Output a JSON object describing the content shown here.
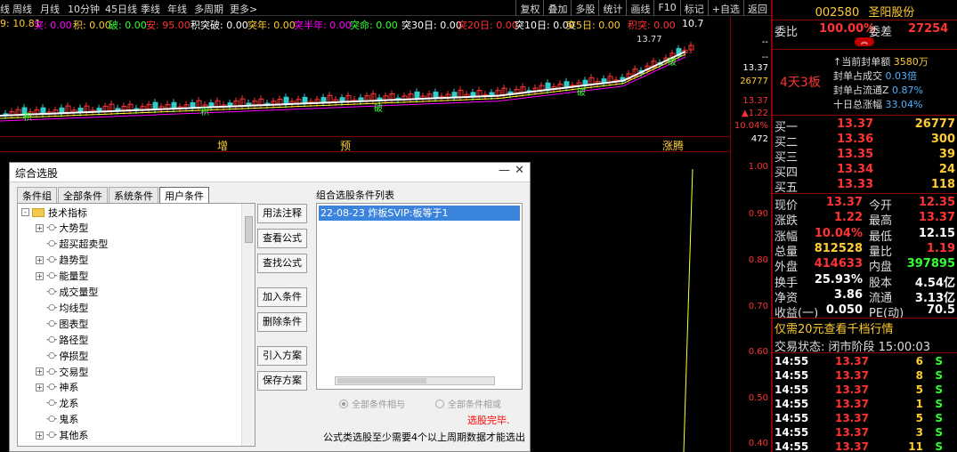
{
  "toolbar": {
    "left_items": [
      "线",
      "周线",
      "月线",
      "10分钟",
      "45日线",
      "季线",
      "年线",
      "多周期",
      "更多>"
    ],
    "right_items": [
      "复权",
      "叠加",
      "多股",
      "统计",
      "画线",
      "F10",
      "标记",
      "+自选",
      "返回"
    ]
  },
  "indicators": [
    {
      "text": "9: 10.81",
      "color": "#ffcc33"
    },
    {
      "text": "突: 0.00",
      "color": "#ff00ff"
    },
    {
      "text": "积: 0.00",
      "color": "#ffcc33"
    },
    {
      "text": "破: 0.00",
      "color": "#33ff33"
    },
    {
      "text": "安: 95.00",
      "color": "#ff3333"
    },
    {
      "text": "积突破: 0.00",
      "color": "#ffffff"
    },
    {
      "text": "突年: 0.00",
      "color": "#ffcc33"
    },
    {
      "text": "突半年: 0.00",
      "color": "#ff00ff"
    },
    {
      "text": "突命: 0.00",
      "color": "#33ff33"
    },
    {
      "text": "突30日: 0.00",
      "color": "#ffffff"
    },
    {
      "text": "突20日: 0.00",
      "color": "#ff3333"
    },
    {
      "text": "突10日: 0.00",
      "color": "#ffffff"
    },
    {
      "text": "突5日: 0.00",
      "color": "#ffcc33"
    },
    {
      "text": "积突: 0.00",
      "color": "#ff3333"
    },
    {
      "text": "10.7",
      "color": "#ffffff"
    }
  ],
  "price_chart": {
    "max_label": "13.77",
    "markers": [
      "积",
      "积",
      "破",
      "破",
      "破"
    ]
  },
  "signals": [
    "增",
    "预",
    "涨腾"
  ],
  "axis": {
    "top": [
      {
        "text": "--",
        "color": "#ffffff"
      },
      {
        "text": "--",
        "color": "#ffffff"
      },
      {
        "text": "13.37",
        "color": "#ffffff"
      },
      {
        "text": "26777",
        "color": "#ffcc33"
      },
      {
        "text": "13.37",
        "color": "#ff3333"
      },
      {
        "text": "▲1.22",
        "color": "#ff3333"
      },
      {
        "text": "10.04%",
        "color": "#ff3333"
      },
      {
        "text": "472",
        "color": "#ffffff"
      }
    ],
    "bottom": [
      "1.00",
      "0.90",
      "0.80",
      "0.70",
      "0.60",
      "0.50",
      "0.40"
    ]
  },
  "quote": {
    "code": "002580",
    "name": "圣阳股份",
    "weibi_label": "委比",
    "weibi_value": "100.00%",
    "weicha_label": "委差",
    "weicha_value": "27254",
    "board": "4天3板",
    "seal": [
      {
        "label": "↑当前封单额",
        "value": "3580万"
      },
      {
        "label": "封单占成交",
        "value": "0.03倍"
      },
      {
        "label": "封单占流通Z",
        "value": "0.87%"
      },
      {
        "label": "十日总涨幅",
        "value": "33.04%"
      }
    ],
    "buy": [
      {
        "label": "买一",
        "price": "13.37",
        "vol": "26777"
      },
      {
        "label": "买二",
        "price": "13.36",
        "vol": "300"
      },
      {
        "label": "买三",
        "price": "13.35",
        "vol": "39"
      },
      {
        "label": "买四",
        "price": "13.34",
        "vol": "24"
      },
      {
        "label": "买五",
        "price": "13.33",
        "vol": "118"
      }
    ],
    "stats": [
      {
        "l1": "现价",
        "v1": "13.37",
        "c1": "#ff3333",
        "l2": "今开",
        "v2": "12.35",
        "c2": "#ff3333"
      },
      {
        "l1": "涨跌",
        "v1": "1.22",
        "c1": "#ff3333",
        "l2": "最高",
        "v2": "13.37",
        "c2": "#ff3333"
      },
      {
        "l1": "涨幅",
        "v1": "10.04%",
        "c1": "#ff3333",
        "l2": "最低",
        "v2": "12.15",
        "c2": "#ffffff"
      },
      {
        "l1": "总量",
        "v1": "812528",
        "c1": "#ffcc33",
        "l2": "量比",
        "v2": "1.19",
        "c2": "#ff3333"
      },
      {
        "l1": "外盘",
        "v1": "414633",
        "c1": "#ff3333",
        "l2": "内盘",
        "v2": "397895",
        "c2": "#33ff33"
      },
      {
        "l1": "换手",
        "v1": "25.93%",
        "c1": "#ffffff",
        "l2": "股本",
        "v2": "4.54亿",
        "c2": "#ffffff"
      },
      {
        "l1": "净资",
        "v1": "3.86",
        "c1": "#ffffff",
        "l2": "流通",
        "v2": "3.13亿",
        "c2": "#ffffff"
      },
      {
        "l1": "收益(一)",
        "v1": "0.050",
        "c1": "#ffffff",
        "l2": "PE(动)",
        "v2": "70.5",
        "c2": "#ffffff"
      }
    ],
    "promo": "仅需20元查看千档行情",
    "trade_status": "交易状态: 闭市阶段 15:00:03",
    "ticks": [
      {
        "time": "14:55",
        "price": "13.37",
        "vol": "6",
        "flag": "S"
      },
      {
        "time": "14:55",
        "price": "13.37",
        "vol": "8",
        "flag": "S"
      },
      {
        "time": "14:55",
        "price": "13.37",
        "vol": "5",
        "flag": "S"
      },
      {
        "time": "14:55",
        "price": "13.37",
        "vol": "1",
        "flag": "S"
      },
      {
        "time": "14:55",
        "price": "13.37",
        "vol": "5",
        "flag": "S"
      },
      {
        "time": "14:55",
        "price": "13.37",
        "vol": "3",
        "flag": "S"
      },
      {
        "time": "14:55",
        "price": "13.37",
        "vol": "11",
        "flag": "S"
      }
    ]
  },
  "dialog": {
    "title": "综合选股",
    "minimize": "—",
    "close": "✕",
    "tabs": [
      "条件组",
      "全部条件",
      "系统条件",
      "用户条件"
    ],
    "tree": [
      {
        "label": "技术指标",
        "level": 0,
        "expand": "-",
        "folder": true
      },
      {
        "label": "大势型",
        "level": 1,
        "expand": "+"
      },
      {
        "label": "超买超卖型",
        "level": 1,
        "expand": ""
      },
      {
        "label": "趋势型",
        "level": 1,
        "expand": "+"
      },
      {
        "label": "能量型",
        "level": 1,
        "expand": "+"
      },
      {
        "label": "成交量型",
        "level": 1,
        "expand": ""
      },
      {
        "label": "均线型",
        "level": 1,
        "expand": ""
      },
      {
        "label": "图表型",
        "level": 1,
        "expand": ""
      },
      {
        "label": "路径型",
        "level": 1,
        "expand": ""
      },
      {
        "label": "停损型",
        "level": 1,
        "expand": ""
      },
      {
        "label": "交易型",
        "level": 1,
        "expand": "+"
      },
      {
        "label": "神系",
        "level": 1,
        "expand": "+"
      },
      {
        "label": "龙系",
        "level": 1,
        "expand": ""
      },
      {
        "label": "鬼系",
        "level": 1,
        "expand": ""
      },
      {
        "label": "其他系",
        "level": 1,
        "expand": "+"
      }
    ],
    "buttons": [
      "用法注释",
      "查看公式",
      "查找公式",
      "加入条件",
      "删除条件",
      "引入方案",
      "保存方案"
    ],
    "list_label": "组合选股条件列表",
    "conditions": [
      "22-08-23 炸板SVIP:板等于1"
    ],
    "radio_and": "全部条件相与",
    "radio_or": "全部条件相或",
    "done": "选股完毕.",
    "hint": "公式类选股至少需要4个以上周期数据才能选出"
  }
}
